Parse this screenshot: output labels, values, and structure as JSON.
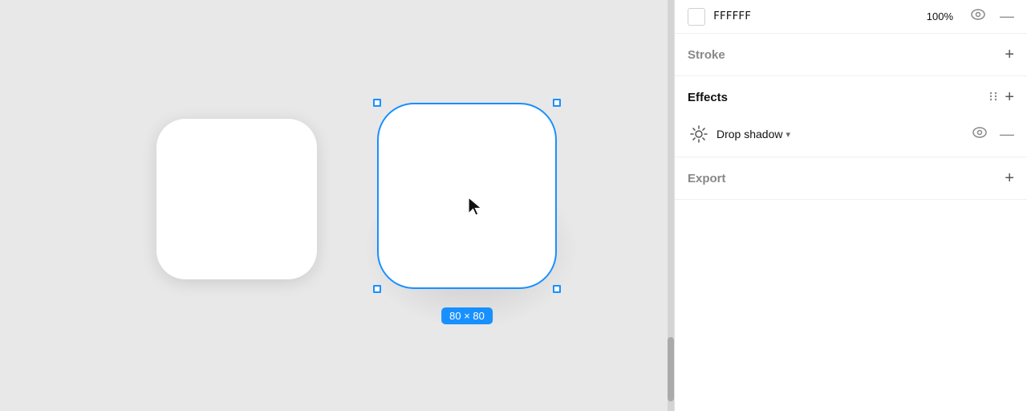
{
  "canvas": {
    "shape_left": {
      "label": "unselected-rectangle"
    },
    "shape_right": {
      "label": "selected-rectangle",
      "dimension": "80 × 80"
    }
  },
  "panel": {
    "fill": {
      "color_hex": "FFFFFF",
      "opacity": "100%",
      "eye_label": "toggle visibility",
      "remove_label": "remove"
    },
    "stroke": {
      "title": "Stroke",
      "add_label": "add stroke"
    },
    "effects": {
      "title": "Effects",
      "add_label": "add effect",
      "items": [
        {
          "type": "Drop shadow",
          "icon": "sun-icon"
        }
      ]
    },
    "export": {
      "title": "Export",
      "add_label": "add export"
    }
  }
}
